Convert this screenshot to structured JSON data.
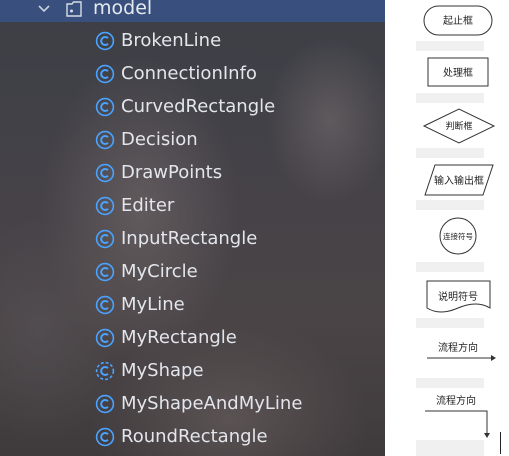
{
  "tree": {
    "package_label": "model",
    "items": [
      {
        "label": "BrokenLine"
      },
      {
        "label": "ConnectionInfo"
      },
      {
        "label": "CurvedRectangle"
      },
      {
        "label": "Decision"
      },
      {
        "label": "DrawPoints"
      },
      {
        "label": "Editer"
      },
      {
        "label": "InputRectangle"
      },
      {
        "label": "MyCircle"
      },
      {
        "label": "MyLine"
      },
      {
        "label": "MyRectangle"
      },
      {
        "label": "MyShape"
      },
      {
        "label": "MyShapeAndMyLine"
      },
      {
        "label": "RoundRectangle"
      }
    ],
    "icon_color": "#4aa3ff",
    "header_color": "#39507e"
  },
  "palette": {
    "terminator_label": "起止框",
    "process_label": "处理框",
    "decision_label": "判断框",
    "io_label": "输入输出框",
    "connector_label": "连接符号",
    "document_label": "说明符号",
    "flow_h_label": "流程方向",
    "flow_v_label": "流程方向"
  }
}
